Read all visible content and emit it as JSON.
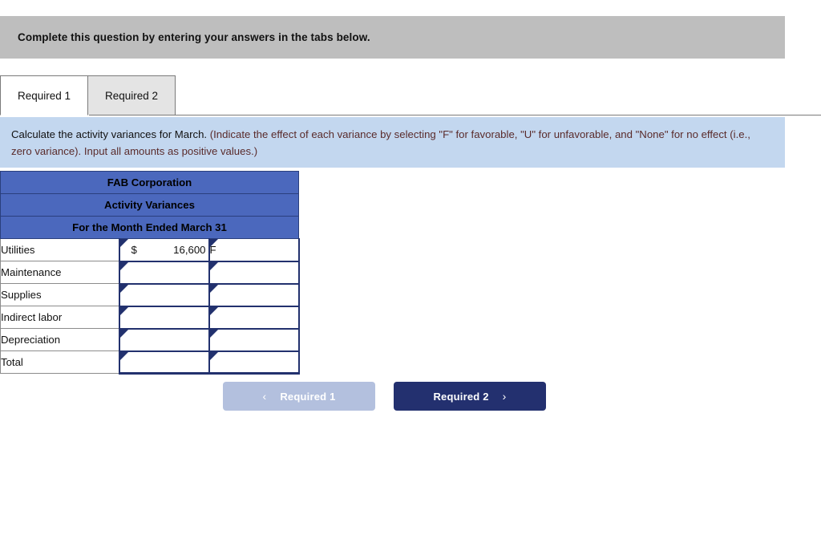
{
  "header": {
    "instruction": "Complete this question by entering your answers in the tabs below."
  },
  "tabs": [
    {
      "label": "Required 1",
      "active": true
    },
    {
      "label": "Required 2",
      "active": false
    }
  ],
  "banner": {
    "lead": "Calculate the activity variances for March.",
    "detail": " (Indicate the effect of each variance by selecting \"F\" for favorable, \"U\" for unfavorable, and \"None\" for no effect (i.e., zero variance). Input all amounts as positive values.)"
  },
  "table": {
    "title_lines": [
      "FAB Corporation",
      "Activity Variances",
      "For the Month Ended March 31"
    ],
    "rows": [
      {
        "label": "Utilities",
        "currency": "$",
        "amount": "16,600",
        "effect": "F"
      },
      {
        "label": "Maintenance",
        "currency": "",
        "amount": "",
        "effect": ""
      },
      {
        "label": "Supplies",
        "currency": "",
        "amount": "",
        "effect": ""
      },
      {
        "label": "Indirect labor",
        "currency": "",
        "amount": "",
        "effect": ""
      },
      {
        "label": "Depreciation",
        "currency": "",
        "amount": "",
        "effect": ""
      },
      {
        "label": "Total",
        "currency": "",
        "amount": "",
        "effect": ""
      }
    ]
  },
  "nav": {
    "prev_label": "Required 1",
    "next_label": "Required 2",
    "prev_chevron": "‹",
    "next_chevron": "›"
  },
  "colors": {
    "gray_bar": "#bebebe",
    "banner_blue": "#c3d7ef",
    "table_header_blue": "#4b68bd",
    "input_border_navy": "#22316e",
    "btn_prev": "#b3c0de",
    "btn_next": "#23306f"
  }
}
